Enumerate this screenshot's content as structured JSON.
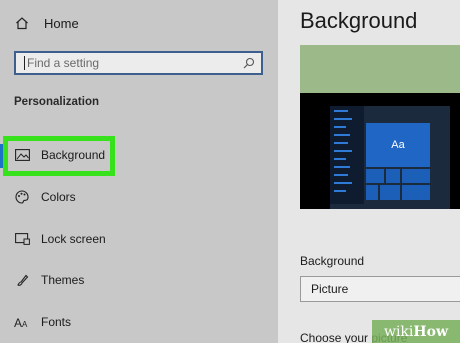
{
  "sidebar": {
    "home_label": "Home",
    "search_placeholder": "Find a setting",
    "section_title": "Personalization",
    "items": [
      {
        "label": "Background",
        "icon": "picture-icon"
      },
      {
        "label": "Colors",
        "icon": "palette-icon"
      },
      {
        "label": "Lock screen",
        "icon": "lock-screen-icon"
      },
      {
        "label": "Themes",
        "icon": "themes-icon"
      },
      {
        "label": "Fonts",
        "icon": "fonts-icon"
      }
    ],
    "selected_item": "Background"
  },
  "main": {
    "title": "Background",
    "preview_tile_text": "Aa",
    "background_label": "Background",
    "background_value": "Picture",
    "choose_label": "Choose your picture"
  },
  "watermark": {
    "wiki": "wiki",
    "how": "How"
  },
  "colors": {
    "highlight": "#37e21d",
    "accent": "#1e73c8",
    "sidebar_bg": "#c8c8c8",
    "main_bg": "#e6e6e6",
    "preview_bg": "#9cb98a"
  }
}
